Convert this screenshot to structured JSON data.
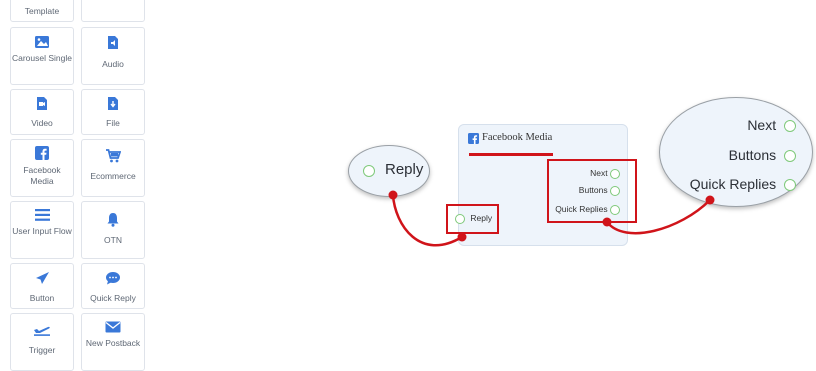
{
  "palette": {
    "items": [
      {
        "label": "Template",
        "icon": "template-icon"
      },
      {
        "label": "",
        "icon": "blank-icon"
      },
      {
        "label": "Carousel Single",
        "icon": "image-icon"
      },
      {
        "label": "Audio",
        "icon": "audio-file-icon"
      },
      {
        "label": "Video",
        "icon": "video-file-icon"
      },
      {
        "label": "File",
        "icon": "download-file-icon"
      },
      {
        "label": "Facebook Media",
        "icon": "facebook-icon"
      },
      {
        "label": "Ecommerce",
        "icon": "cart-icon"
      },
      {
        "label": "User Input Flow",
        "icon": "list-icon"
      },
      {
        "label": "OTN",
        "icon": "bell-icon"
      },
      {
        "label": "Button",
        "icon": "send-icon"
      },
      {
        "label": "Quick Reply",
        "icon": "chat-bubble-icon"
      },
      {
        "label": "Trigger",
        "icon": "plane-icon"
      },
      {
        "label": "New Postback",
        "icon": "envelope-icon"
      }
    ],
    "accent_color": "#3a78d8"
  },
  "canvas": {
    "reply_ellipse_label": "Reply",
    "node": {
      "title": "Facebook Media",
      "input_port": "Reply",
      "outputs": [
        "Next",
        "Buttons",
        "Quick Replies"
      ]
    },
    "zoom_ellipse_outputs": [
      "Next",
      "Buttons",
      "Quick Replies"
    ],
    "highlight_color": "#d0141a",
    "port_color": "#7fc97a"
  }
}
